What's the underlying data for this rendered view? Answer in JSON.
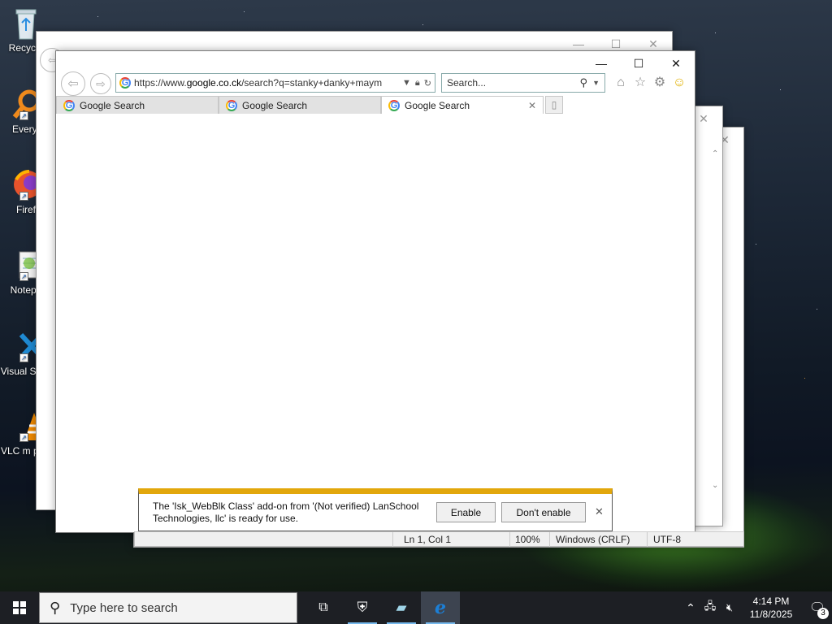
{
  "desktop_icons": [
    {
      "name": "recycle",
      "label": "Recycle"
    },
    {
      "name": "everything",
      "label": "Everyt"
    },
    {
      "name": "firefox",
      "label": "Firef"
    },
    {
      "name": "notepad",
      "label": "Notepa"
    },
    {
      "name": "vscode",
      "label": "Visual S Co"
    },
    {
      "name": "vlc",
      "label": "VLC m play"
    }
  ],
  "browser": {
    "address_url_prefix": "https://www.",
    "address_url_domain": "google.co.ck",
    "address_url_rest": "/search?q=stanky+danky+maym",
    "search_placeholder": "Search...",
    "tabs": [
      {
        "label": "Google Search"
      },
      {
        "label": "Google Search"
      },
      {
        "label": "Google Search"
      }
    ]
  },
  "notification": {
    "message": "The 'Isk_WebBlk Class' add-on from '(Not verified) LanSchool Technologies, llc' is ready for use.",
    "enable_label": "Enable",
    "dont_enable_label": "Don't enable"
  },
  "notepad_status": {
    "position": "Ln 1, Col 1",
    "zoom": "100%",
    "line_ending": "Windows (CRLF)",
    "encoding": "UTF-8"
  },
  "taskbar": {
    "search_placeholder": "Type here to search",
    "time": "4:14 PM",
    "date": "11/8/2025",
    "notification_count": "3"
  },
  "colors": {
    "notification_accent": "#e2a70c",
    "taskbar": "#1d1f24",
    "ie_blue": "#1c7fd6"
  }
}
